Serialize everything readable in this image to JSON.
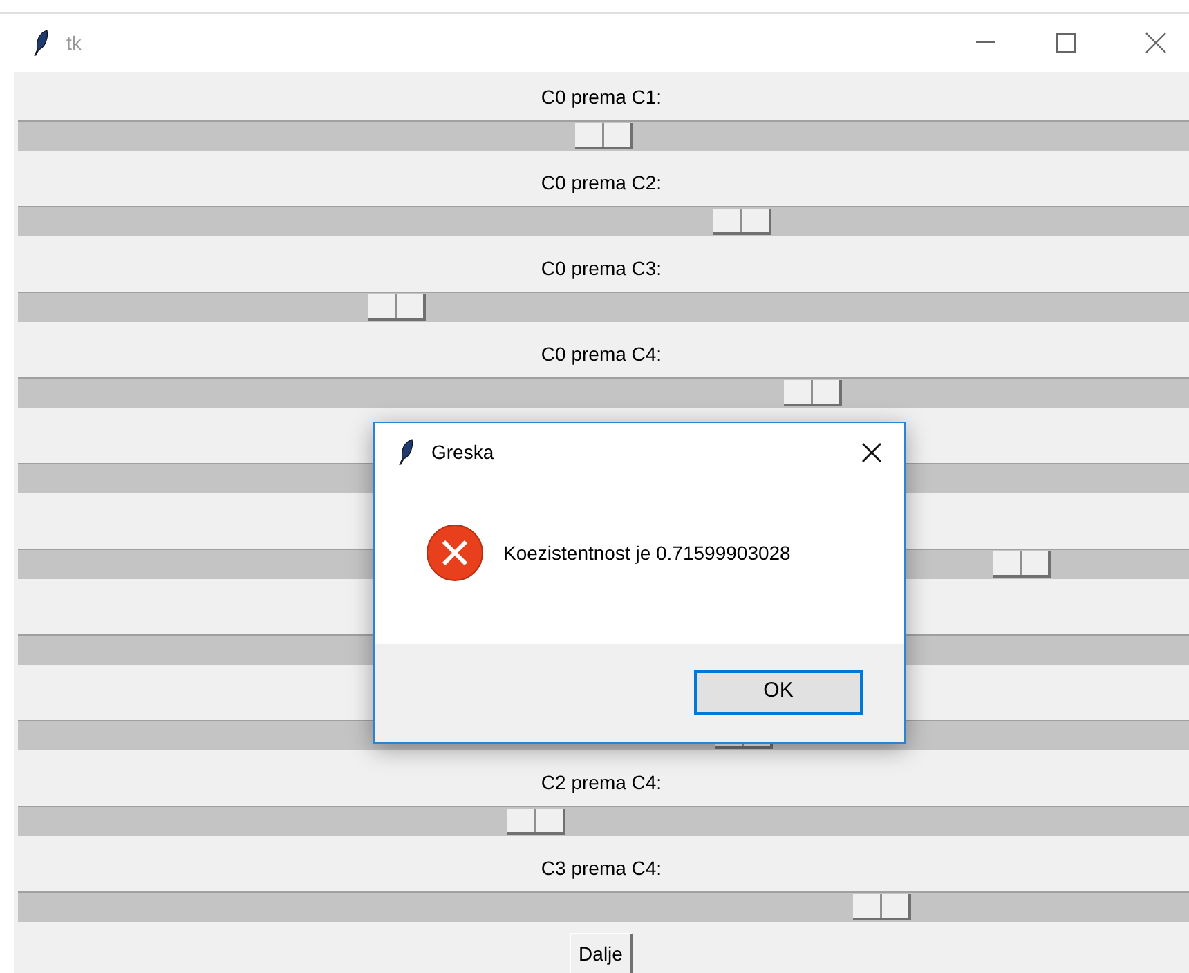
{
  "window": {
    "title": "tk"
  },
  "scales": [
    {
      "kind": "labeled",
      "label": "C0 prema C1:",
      "level": 0.5
    },
    {
      "kind": "labeled",
      "label": "C0 prema C2:",
      "level": 0.625
    },
    {
      "kind": "labeled",
      "label": "C0 prema C3:",
      "level": 0.314
    },
    {
      "kind": "labeled",
      "label": "C0 prema C4:",
      "level": 0.688
    },
    {
      "kind": "bare"
    },
    {
      "kind": "bare",
      "level": 0.876
    },
    {
      "kind": "bare"
    },
    {
      "kind": "bare",
      "level": 0.626
    },
    {
      "kind": "labeled",
      "label": "C2 prema C4:",
      "level": 0.44
    },
    {
      "kind": "labeled",
      "label": "C3 prema C4:",
      "level": 0.75
    }
  ],
  "button": "Dalje",
  "dialog": {
    "title": "Greska",
    "message": "Koezistentnost je 0.71599903028",
    "ok": "OK"
  }
}
